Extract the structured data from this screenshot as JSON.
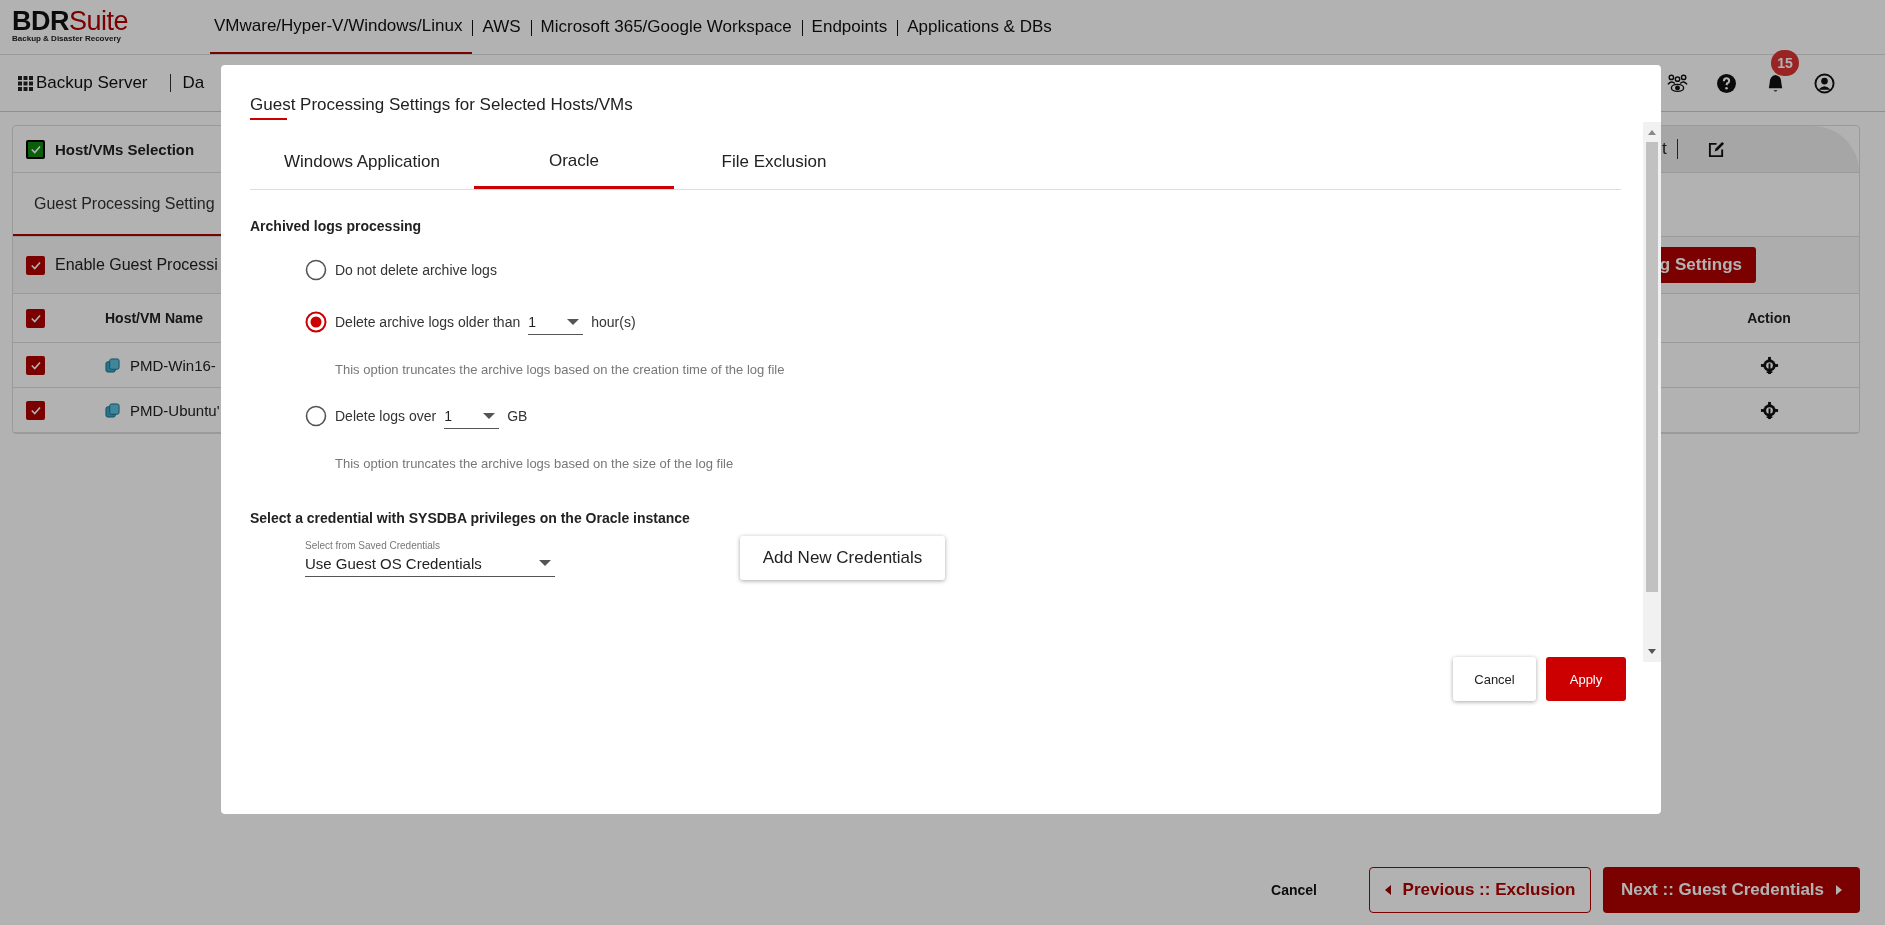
{
  "app": {
    "logo": {
      "brand": "BDR",
      "brand_accent": "Suite",
      "tagline": "Backup & Disaster Recovery"
    },
    "nav": [
      {
        "label": "VMware/Hyper-V/Windows/Linux",
        "selected": true
      },
      {
        "label": "AWS",
        "selected": false
      },
      {
        "label": "Microsoft 365/Google Workspace",
        "selected": false
      },
      {
        "label": "Endpoints",
        "selected": false
      },
      {
        "label": "Applications & DBs",
        "selected": false
      }
    ],
    "toolbar": {
      "items": [
        "Backup Server",
        "Da"
      ],
      "notification_count": "15"
    }
  },
  "wizard": {
    "step": {
      "label": "Host/VMs Selection",
      "checked": true
    },
    "step_fragment": "t",
    "subtab": {
      "label": "Guest Processing Setting",
      "selected": true
    },
    "enable": {
      "label": "Enable Guest Processi",
      "checked": true
    },
    "settings_button": "g Settings",
    "table": {
      "header_checked": true,
      "columns": [
        "Host/VM Name",
        "Action"
      ],
      "rows": [
        {
          "name": "PMD-Win16-",
          "checked": true
        },
        {
          "name": "PMD-Ubuntu'",
          "checked": true
        }
      ]
    }
  },
  "footer": {
    "cancel": "Cancel",
    "previous": "Previous :: Exclusion",
    "next": "Next :: Guest Credentials"
  },
  "dialog": {
    "title": "Guest Processing Settings for Selected Hosts/VMs",
    "tabs": [
      {
        "label": "Windows Application",
        "selected": false
      },
      {
        "label": "Oracle",
        "selected": true
      },
      {
        "label": "File Exclusion",
        "selected": false
      }
    ],
    "archive_heading": "Archived logs processing",
    "options": [
      {
        "kind": "plain",
        "label": "Do not delete archive logs",
        "selected": false
      },
      {
        "kind": "select",
        "label": "Delete archive logs older than",
        "value": "1",
        "unit": "hour(s)",
        "hint": "This option truncates the archive logs based on the creation time of the log file",
        "selected": true
      },
      {
        "kind": "select",
        "label": "Delete logs over",
        "value": "1",
        "unit": "GB",
        "hint": "This option truncates the archive logs based on the size of the log file",
        "selected": false
      }
    ],
    "credential_heading": "Select a credential with SYSDBA privileges on the Oracle instance",
    "credential_select": {
      "label": "Select from Saved Credentials",
      "value": "Use Guest OS Credentials"
    },
    "add_button": "Add New Credentials",
    "buttons": [
      {
        "kind": "secondary",
        "label": "Cancel"
      },
      {
        "kind": "primary",
        "label": "Apply"
      }
    ]
  }
}
